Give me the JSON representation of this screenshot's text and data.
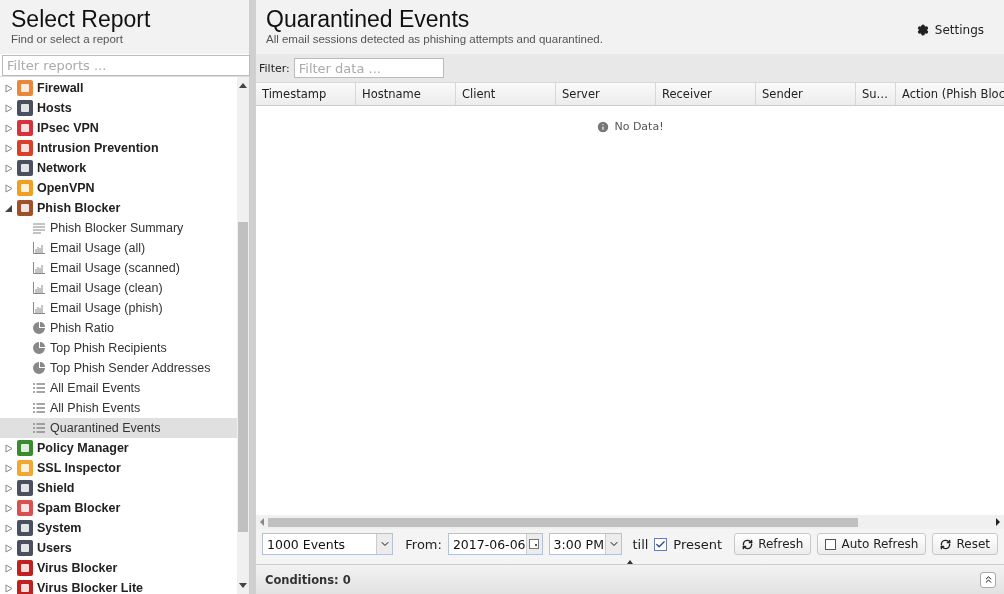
{
  "sidebar": {
    "title": "Select Report",
    "subtitle": "Find or select a report",
    "filter": {
      "placeholder": "Filter reports ..."
    },
    "tree": [
      {
        "label": "Firewall",
        "color": "#e8883a",
        "expanded": false
      },
      {
        "label": "Hosts",
        "color": "#4a5060",
        "expanded": false
      },
      {
        "label": "IPsec VPN",
        "color": "#d6323a",
        "expanded": false
      },
      {
        "label": "Intrusion Prevention",
        "color": "#d8402a",
        "expanded": false
      },
      {
        "label": "Network",
        "color": "#4a5060",
        "expanded": false
      },
      {
        "label": "OpenVPN",
        "color": "#f0a020",
        "expanded": false
      },
      {
        "label": "Phish Blocker",
        "color": "#a0502a",
        "expanded": true,
        "children": [
          {
            "label": "Phish Blocker Summary",
            "kind": "summary",
            "selected": false
          },
          {
            "label": "Email Usage (all)",
            "kind": "bar",
            "selected": false
          },
          {
            "label": "Email Usage (scanned)",
            "kind": "bar",
            "selected": false
          },
          {
            "label": "Email Usage (clean)",
            "kind": "bar",
            "selected": false
          },
          {
            "label": "Email Usage (phish)",
            "kind": "bar",
            "selected": false
          },
          {
            "label": "Phish Ratio",
            "kind": "pie",
            "selected": false
          },
          {
            "label": "Top Phish Recipients",
            "kind": "pie",
            "selected": false
          },
          {
            "label": "Top Phish Sender Addresses",
            "kind": "pie",
            "selected": false
          },
          {
            "label": "All Email Events",
            "kind": "list",
            "selected": false
          },
          {
            "label": "All Phish Events",
            "kind": "list",
            "selected": false
          },
          {
            "label": "Quarantined Events",
            "kind": "list",
            "selected": true
          }
        ]
      },
      {
        "label": "Policy Manager",
        "color": "#3a8a30",
        "expanded": false
      },
      {
        "label": "SSL Inspector",
        "color": "#f0a830",
        "expanded": false
      },
      {
        "label": "Shield",
        "color": "#4a5060",
        "expanded": false
      },
      {
        "label": "Spam Blocker",
        "color": "#d85050",
        "expanded": false
      },
      {
        "label": "System",
        "color": "#4a5060",
        "expanded": false
      },
      {
        "label": "Users",
        "color": "#4a5060",
        "expanded": false
      },
      {
        "label": "Virus Blocker",
        "color": "#c02020",
        "expanded": false
      },
      {
        "label": "Virus Blocker Lite",
        "color": "#c02020",
        "expanded": false
      }
    ]
  },
  "report": {
    "title": "Quarantined Events",
    "subtitle": "All email sessions detected as phishing attempts and quarantined.",
    "settings": "Settings",
    "filter": {
      "label": "Filter:",
      "placeholder": "Filter data ..."
    },
    "columns": [
      "Timestamp",
      "Hostname",
      "Client",
      "Server",
      "Receiver",
      "Sender",
      "Su…",
      "Action (Phish Bloc"
    ],
    "empty": "No Data!"
  },
  "toolbar": {
    "limit": "1000 Events",
    "from_label": "From:",
    "date": "2017-06-06",
    "time": "3:00 PM",
    "till": "till",
    "present": {
      "label": "Present",
      "checked": true
    },
    "refresh": "Refresh",
    "auto_refresh": {
      "label": "Auto Refresh",
      "checked": false
    },
    "reset": "Reset"
  },
  "conditions": "Conditions: 0"
}
